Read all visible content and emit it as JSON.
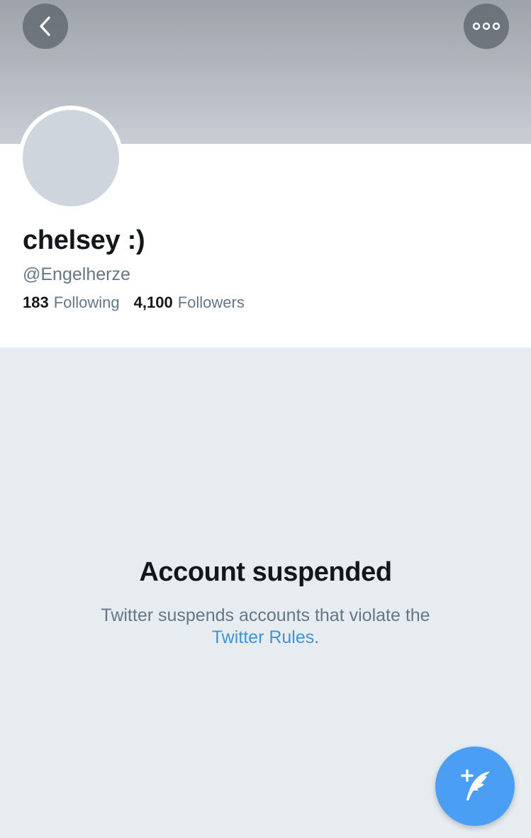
{
  "header": {
    "back_icon": "chevron-left-icon",
    "more_icon": "more-options-icon"
  },
  "profile": {
    "display_name": "chelsey :)",
    "handle": "@Engelherze",
    "following_count": "183",
    "following_label": "Following",
    "followers_count": "4,100",
    "followers_label": "Followers"
  },
  "suspension": {
    "title": "Account suspended",
    "message_prefix": "Twitter suspends accounts that violate the",
    "link_text": "Twitter Rules",
    "message_suffix": "."
  },
  "compose": {
    "icon": "compose-tweet-icon"
  },
  "colors": {
    "accent": "#4a9ff5",
    "link": "#3f93d8",
    "text_primary": "#14171a",
    "text_secondary": "#657786",
    "background": "#e6ecf0"
  }
}
